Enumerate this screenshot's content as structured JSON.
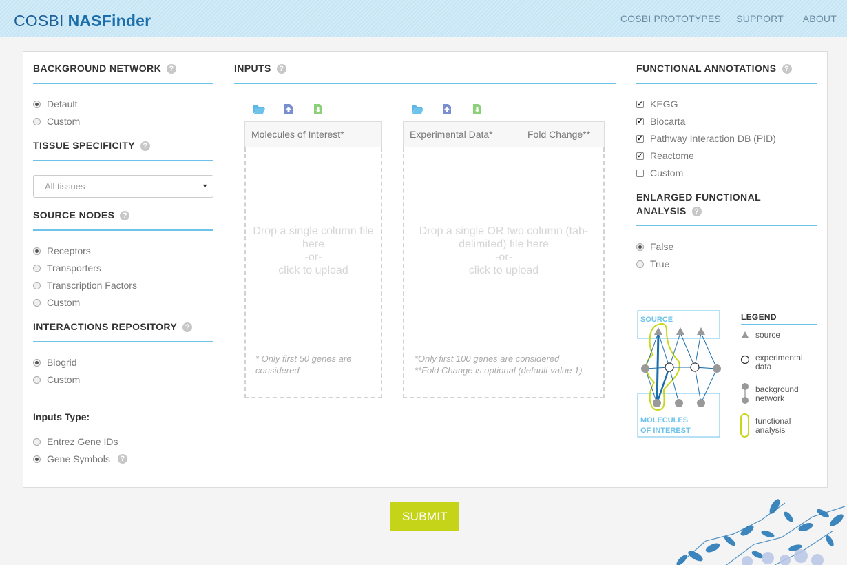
{
  "header": {
    "brand_part1": "COSBI",
    "brand_part2": "NASFinder",
    "nav": [
      "COSBI PROTOTYPES",
      "SUPPORT",
      "ABOUT"
    ]
  },
  "background_network": {
    "title": "BACKGROUND NETWORK",
    "options": [
      {
        "label": "Default",
        "selected": true
      },
      {
        "label": "Custom",
        "selected": false
      }
    ]
  },
  "tissue_specificity": {
    "title": "TISSUE SPECIFICITY",
    "selected": "All tissues"
  },
  "source_nodes": {
    "title": "SOURCE NODES",
    "options": [
      {
        "label": "Receptors",
        "selected": true
      },
      {
        "label": "Transporters",
        "selected": false
      },
      {
        "label": "Transcription Factors",
        "selected": false
      },
      {
        "label": "Custom",
        "selected": false
      }
    ]
  },
  "interactions_repository": {
    "title": "INTERACTIONS REPOSITORY",
    "options": [
      {
        "label": "Biogrid",
        "selected": true
      },
      {
        "label": "Custom",
        "selected": false
      }
    ]
  },
  "inputs_type": {
    "title": "Inputs Type:",
    "options": [
      {
        "label": "Entrez Gene IDs",
        "selected": false
      },
      {
        "label": "Gene Symbols",
        "selected": true
      }
    ]
  },
  "inputs": {
    "title": "INPUTS",
    "molecules": {
      "header": "Molecules of Interest*",
      "drop_line1": "Drop a single column file",
      "drop_line2": "here",
      "drop_line3": "-or-",
      "drop_line4": "click to upload",
      "note_line1": "* Only first 50 genes are",
      "note_line2": "considered"
    },
    "experimental": {
      "header1": "Experimental Data*",
      "header2": "Fold Change**",
      "drop_line1": "Drop a single OR two column (tab-",
      "drop_line2": "delimited) file here",
      "drop_line3": "-or-",
      "drop_line4": "click to upload",
      "note_line1": "*Only first 100 genes are considered",
      "note_line2": "**Fold Change is optional (default value 1)"
    }
  },
  "functional_annotations": {
    "title": "FUNCTIONAL ANNOTATIONS",
    "options": [
      {
        "label": "KEGG",
        "checked": true
      },
      {
        "label": "Biocarta",
        "checked": true
      },
      {
        "label": "Pathway Interaction DB (PID)",
        "checked": true
      },
      {
        "label": "Reactome",
        "checked": true
      },
      {
        "label": "Custom",
        "checked": false
      }
    ]
  },
  "enlarged_analysis": {
    "title_line1": "ENLARGED FUNCTIONAL",
    "title_line2": "ANALYSIS",
    "options": [
      {
        "label": "False",
        "selected": true
      },
      {
        "label": "True",
        "selected": false
      }
    ]
  },
  "diagram": {
    "source_label": "SOURCE",
    "moi_line1": "MOLECULES",
    "moi_line2": "OF INTEREST",
    "legend_title": "LEGEND",
    "legend_source": "source",
    "legend_exp1": "experimental",
    "legend_exp2": "data",
    "legend_bg1": "background",
    "legend_bg2": "network",
    "legend_fa1": "functional",
    "legend_fa2": "analysis"
  },
  "submit_label": "SUBMIT",
  "colors": {
    "accent": "#6ec3ea",
    "submit": "#c5d418",
    "brand": "#1d6fab"
  }
}
